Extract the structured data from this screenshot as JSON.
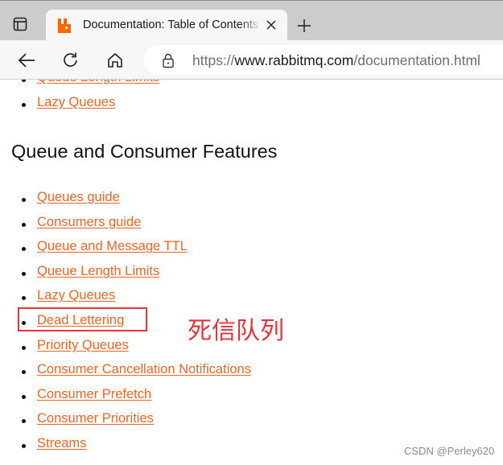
{
  "browser": {
    "tab": {
      "title": "Documentation: Table of Contents",
      "favicon": "rabbitmq-logo-icon",
      "favicon_color": "#ff6600"
    },
    "new_tab_label": "+",
    "address_bar": {
      "url_scheme": "https://",
      "url_host": "www.rabbitmq.com",
      "url_path": "/documentation.html"
    },
    "icons": {
      "tab_actions": "tab-actions-icon",
      "close": "close-icon",
      "back": "back-arrow-icon",
      "reload": "reload-icon",
      "home": "home-icon",
      "lock": "lock-icon"
    }
  },
  "page": {
    "link_color": "#f26522",
    "previous_section_links": [
      {
        "label": "Queue Length Limits"
      },
      {
        "label": "Lazy Queues"
      }
    ],
    "section_heading": "Queue and Consumer Features",
    "section_links": [
      {
        "label": "Queues guide"
      },
      {
        "label": "Consumers guide"
      },
      {
        "label": "Queue and Message TTL"
      },
      {
        "label": "Queue Length Limits"
      },
      {
        "label": "Lazy Queues"
      },
      {
        "label": "Dead Lettering"
      },
      {
        "label": "Priority Queues"
      },
      {
        "label": "Consumer Cancellation Notifications"
      },
      {
        "label": "Consumer Prefetch"
      },
      {
        "label": "Consumer Priorities"
      },
      {
        "label": "Streams"
      }
    ]
  },
  "annotation": {
    "highlighted_item": "Dead Lettering",
    "text": "死信队列",
    "color": "#e8333a"
  },
  "watermark": "CSDN @Perley620"
}
